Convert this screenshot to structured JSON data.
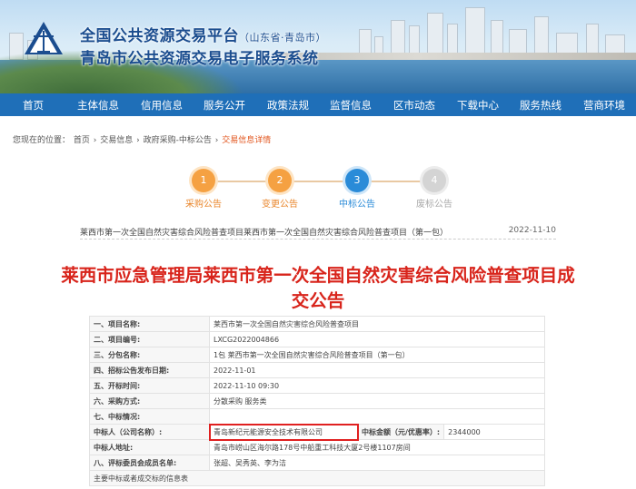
{
  "header": {
    "title": "全国公共资源交易平台",
    "region": "（山东省·青岛市）",
    "subtitle": "青岛市公共资源交易电子服务系统"
  },
  "nav": [
    "首页",
    "主体信息",
    "信用信息",
    "服务公开",
    "政策法规",
    "监督信息",
    "区市动态",
    "下载中心",
    "服务热线",
    "营商环境"
  ],
  "breadcrumb": {
    "prefix": "您现在的位置：",
    "items": [
      "首页",
      "交易信息",
      "政府采购-中标公告"
    ],
    "current": "交易信息详情",
    "sep": "›"
  },
  "steps": [
    {
      "num": "1",
      "label": "采购公告",
      "state": "done"
    },
    {
      "num": "2",
      "label": "变更公告",
      "state": "done"
    },
    {
      "num": "3",
      "label": "中标公告",
      "state": "current"
    },
    {
      "num": "4",
      "label": "废标公告",
      "state": "pending"
    }
  ],
  "project_line": {
    "text": "莱西市第一次全国自然灾害综合风险普查项目莱西市第一次全国自然灾害综合风险普查项目（第一包）",
    "date": "2022-11-10"
  },
  "headline": "莱西市应急管理局莱西市第一次全国自然灾害综合风险普查项目成交公告",
  "table": {
    "rows": [
      {
        "k": "一、项目名称:",
        "v": "莱西市第一次全国自然灾害综合风险普查项目"
      },
      {
        "k": "二、项目编号:",
        "v": "LXCG2022004866"
      },
      {
        "k": "三、分包名称:",
        "v": "1包  莱西市第一次全国自然灾害综合风险普查项目（第一包）"
      },
      {
        "k": "四、招标公告发布日期:",
        "v": "2022-11-01"
      },
      {
        "k": "五、开标时间:",
        "v": "2022-11-10  09:30"
      },
      {
        "k": "六、采购方式:",
        "v": "分散采购  服务类"
      },
      {
        "k": "七、中标情况:",
        "v": ""
      }
    ],
    "winner_label": "中标人（公司名称）:",
    "winner_name": "青岛新纪元能源安全技术有限公司",
    "amount_label": "中标金额（元/优惠率）:",
    "amount": "2344000",
    "address_label": "中标人地址:",
    "address": "青岛市崂山区海尔路178号中船重工科技大厦2号楼1107房间",
    "panel_label": "八、评标委员会成员名单:",
    "panel": "张超、吴秀英、李为洁",
    "footer": "主要中标或者成交标的信息表"
  },
  "colors": {
    "nav": "#1f6fb8",
    "headline": "#d8241b",
    "accent": "#e2541c",
    "highlight": "#e02020"
  }
}
